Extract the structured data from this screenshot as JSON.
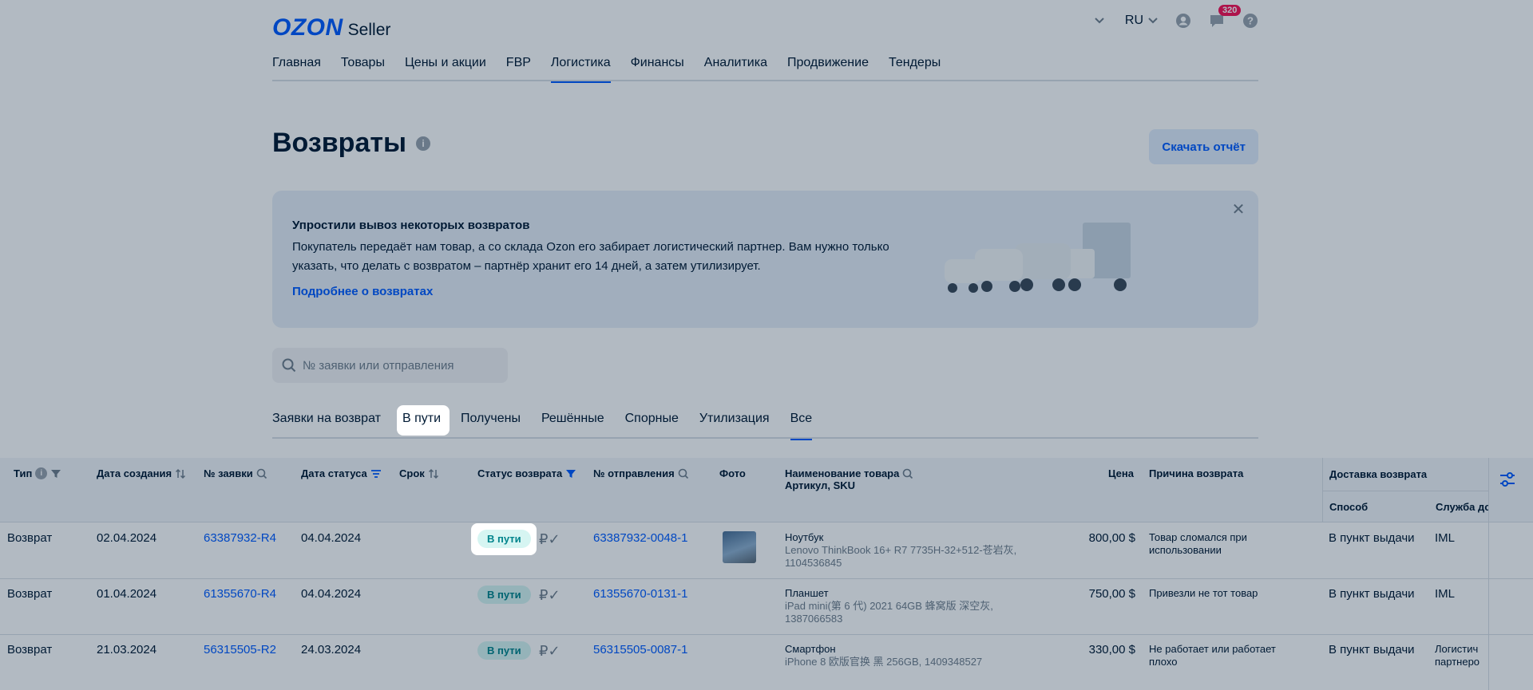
{
  "header": {
    "logo_brand": "OZON",
    "logo_product": "Seller",
    "lang": "RU",
    "notifications_count": "320"
  },
  "nav": {
    "items": [
      {
        "label": "Главная"
      },
      {
        "label": "Товары"
      },
      {
        "label": "Цены и акции"
      },
      {
        "label": "FBP"
      },
      {
        "label": "Логистика",
        "active": true
      },
      {
        "label": "Финансы"
      },
      {
        "label": "Аналитика"
      },
      {
        "label": "Продвижение"
      },
      {
        "label": "Тендеры"
      }
    ]
  },
  "page": {
    "title": "Возвраты",
    "download_label": "Скачать отчёт"
  },
  "banner": {
    "title": "Упростили вывоз некоторых возвратов",
    "text": "Покупатель передаёт нам товар, а со склада Ozon его забирает логистический партнер. Вам нужно только указать, что делать с возвратом – партнёр хранит его 14 дней, а затем утилизирует.",
    "link": "Подробнее о возвратах"
  },
  "search": {
    "placeholder": "№ заявки или отправления",
    "value": ""
  },
  "subtabs": {
    "items": [
      {
        "label": "Заявки на возврат"
      },
      {
        "label": "В пути",
        "highlight": true
      },
      {
        "label": "Получены"
      },
      {
        "label": "Решённые"
      },
      {
        "label": "Спорные"
      },
      {
        "label": "Утилизация"
      },
      {
        "label": "Все",
        "active": true
      }
    ]
  },
  "table": {
    "headers": {
      "type": "Тип",
      "created": "Дата создания",
      "request": "№ заявки",
      "status_date": "Дата статуса",
      "term": "Срок",
      "status": "Статус возврата",
      "shipment": "№ отправления",
      "photo": "Фото",
      "product": "Наименование товара",
      "product_sub": "Артикул, SKU",
      "price": "Цена",
      "reason": "Причина возврата",
      "delivery": "Доставка возврата",
      "method": "Способ",
      "service": "Служба до"
    },
    "rows": [
      {
        "type": "Возврат",
        "created": "02.04.2024",
        "request": "63387932-R4",
        "status_date": "04.04.2024",
        "status": "В пути",
        "shipment": "63387932-0048-1",
        "product_name": "Ноутбук",
        "product_details": "Lenovo ThinkBook 16+ R7 7735H-32+512-苍岩灰, 1104536845",
        "price": "800,00 $",
        "reason": "Товар сломался при использовании",
        "method": "В пункт выдачи",
        "service": "IML"
      },
      {
        "type": "Возврат",
        "created": "01.04.2024",
        "request": "61355670-R4",
        "status_date": "04.04.2024",
        "status": "В пути",
        "shipment": "61355670-0131-1",
        "product_name": "Планшет",
        "product_details": "iPad mini(第 6 代) 2021 64GB 蜂窝版 深空灰, 1387066583",
        "price": "750,00 $",
        "reason": "Привезли не тот товар",
        "method": "В пункт выдачи",
        "service": "IML"
      },
      {
        "type": "Возврат",
        "created": "21.03.2024",
        "request": "56315505-R2",
        "status_date": "24.03.2024",
        "status": "В пути",
        "shipment": "56315505-0087-1",
        "product_name": "Смартфон",
        "product_details": "iPhone 8 欧版官换 黑 256GB, 1409348527",
        "price": "330,00 $",
        "reason": "Не работает или работает плохо",
        "method": "В пункт выдачи",
        "service": "Логистич партнеро"
      }
    ]
  }
}
